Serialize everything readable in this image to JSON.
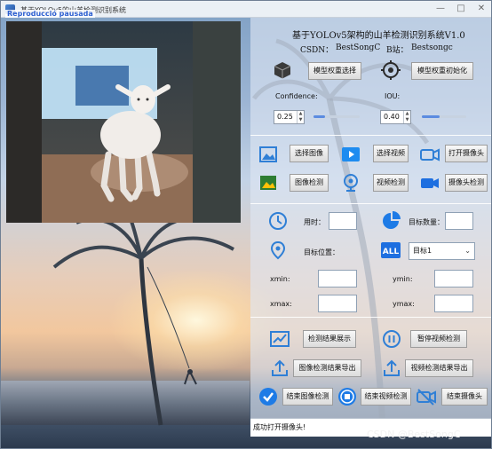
{
  "window": {
    "title": "基于YOLOv5的山羊检测识别系统",
    "overlay_label": "Reproducció pausada",
    "minimize": "—",
    "maximize": "□",
    "close": "✕"
  },
  "header": {
    "system_title": "基于YOLOv5架构的山羊检测识别系统V1.0",
    "csdn_label": "CSDN：",
    "csdn_value": "BestSongC",
    "bili_label": "B站：",
    "bili_value": "Bestsongc"
  },
  "model": {
    "select_button": "模型权重选择",
    "init_button": "模型权重初始化",
    "select_icon": "cube-icon",
    "init_icon": "target-icon"
  },
  "params": {
    "confidence_label": "Confidence:",
    "confidence_value": "0.25",
    "confidence_fraction": 0.25,
    "iou_label": "IOU:",
    "iou_value": "0.40",
    "iou_fraction": 0.4
  },
  "source": {
    "image_select": "选择图像",
    "video_select": "选择视频",
    "camera_open": "打开摄像头",
    "image_detect": "图像检测",
    "video_detect": "视频检测",
    "camera_detect": "摄像头检测"
  },
  "results": {
    "time_label": "用时：",
    "time_value": "",
    "count_label": "目标数量：",
    "count_value": "",
    "position_label": "目标位置：",
    "target_option": "目标1",
    "xmin_label": "xmin:",
    "ymin_label": "ymin:",
    "xmax_label": "xmax:",
    "ymax_label": "ymax:"
  },
  "actions": {
    "show_results": "检测结果展示",
    "pause_video": "暂停视频检测",
    "export_image": "图像检测结果导出",
    "export_video": "视频检测结果导出",
    "end_image": "结束图像检测",
    "end_video": "结束视频检测",
    "end_camera": "结束摄像头"
  },
  "status": {
    "message": "成功打开摄像头!"
  },
  "watermark": "CSDN @BestSongC",
  "colors": {
    "accent_blue": "#2f7fd6",
    "panel_tint": "#dee7f3",
    "button_face": "#e9e9e9"
  }
}
